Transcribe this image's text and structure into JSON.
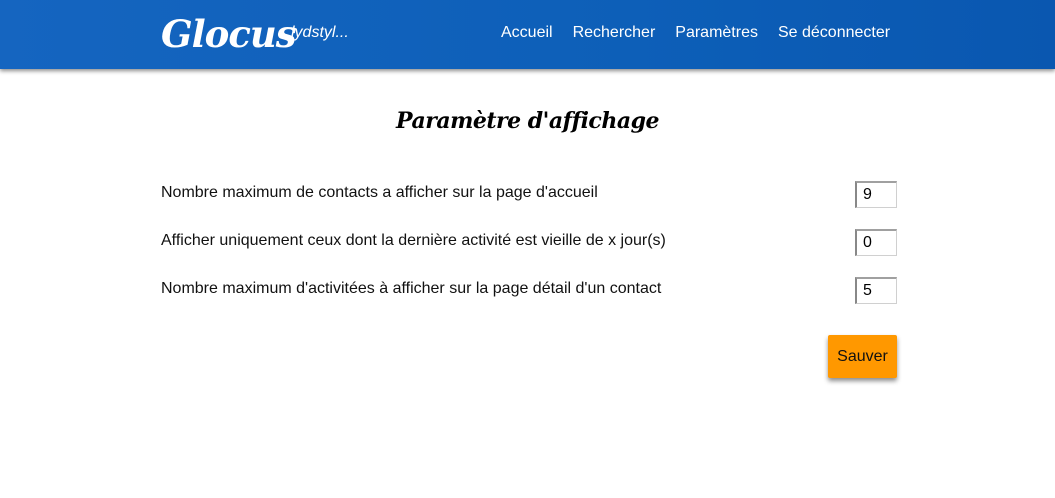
{
  "header": {
    "logo": "Glocus",
    "username": "lydstyl...",
    "nav": [
      {
        "label": "Accueil"
      },
      {
        "label": "Rechercher"
      },
      {
        "label": "Paramètres"
      },
      {
        "label": "Se déconnecter"
      }
    ]
  },
  "main": {
    "title": "Paramètre d'affichage",
    "settings": [
      {
        "label": "Nombre maximum de contacts a afficher sur la page d'accueil",
        "value": "9"
      },
      {
        "label": "Afficher uniquement ceux dont la dernière activité est vieille de x jour(s)",
        "value": "0"
      },
      {
        "label": "Nombre maximum d'activitées à afficher sur la page détail d'un contact",
        "value": "5"
      }
    ],
    "save_label": "Sauver"
  },
  "colors": {
    "navbar": "#1565c0",
    "accent_button": "#ff9800"
  }
}
